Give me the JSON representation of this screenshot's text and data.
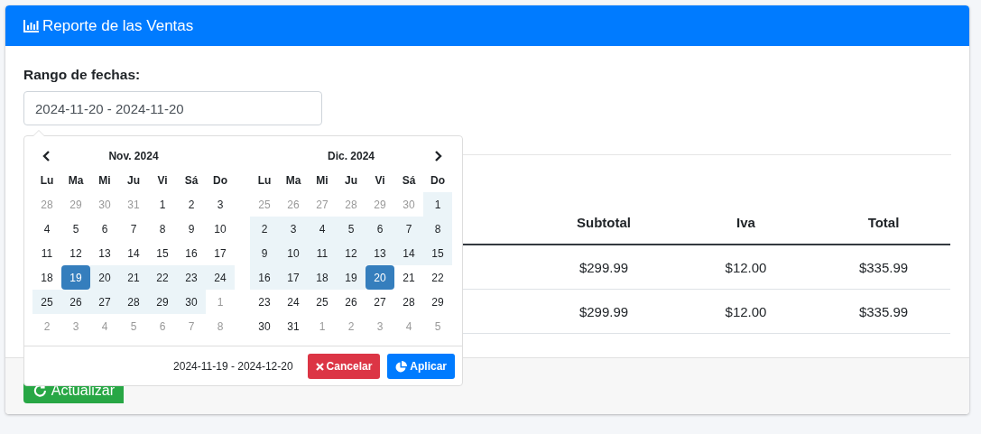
{
  "card": {
    "title": "Reporte de las Ventas"
  },
  "date_range": {
    "label": "Rango de fechas:",
    "value": "2024-11-20 - 2024-11-20"
  },
  "table": {
    "columns": [
      "Subtotal",
      "Iva",
      "Total"
    ],
    "rows": [
      [
        "$299.99",
        "$12.00",
        "$335.99"
      ],
      [
        "$299.99",
        "$12.00",
        "$335.99"
      ]
    ]
  },
  "footer": {
    "refresh_button": "Actualizar"
  },
  "date_picker": {
    "calendars": [
      {
        "month": "Nov. 2024",
        "weekdays": [
          "Lu",
          "Ma",
          "Mi",
          "Ju",
          "Vi",
          "Sá",
          "Do"
        ],
        "weeks": [
          [
            {
              "d": "28",
              "off": true,
              "in_range": false,
              "selected": false
            },
            {
              "d": "29",
              "off": true,
              "in_range": false,
              "selected": false
            },
            {
              "d": "30",
              "off": true,
              "in_range": false,
              "selected": false
            },
            {
              "d": "31",
              "off": true,
              "in_range": false,
              "selected": false
            },
            {
              "d": "1",
              "off": false,
              "in_range": false,
              "selected": false
            },
            {
              "d": "2",
              "off": false,
              "in_range": false,
              "selected": false
            },
            {
              "d": "3",
              "off": false,
              "in_range": false,
              "selected": false
            }
          ],
          [
            {
              "d": "4",
              "off": false,
              "in_range": false,
              "selected": false
            },
            {
              "d": "5",
              "off": false,
              "in_range": false,
              "selected": false
            },
            {
              "d": "6",
              "off": false,
              "in_range": false,
              "selected": false
            },
            {
              "d": "7",
              "off": false,
              "in_range": false,
              "selected": false
            },
            {
              "d": "8",
              "off": false,
              "in_range": false,
              "selected": false
            },
            {
              "d": "9",
              "off": false,
              "in_range": false,
              "selected": false
            },
            {
              "d": "10",
              "off": false,
              "in_range": false,
              "selected": false
            }
          ],
          [
            {
              "d": "11",
              "off": false,
              "in_range": false,
              "selected": false
            },
            {
              "d": "12",
              "off": false,
              "in_range": false,
              "selected": false
            },
            {
              "d": "13",
              "off": false,
              "in_range": false,
              "selected": false
            },
            {
              "d": "14",
              "off": false,
              "in_range": false,
              "selected": false
            },
            {
              "d": "15",
              "off": false,
              "in_range": false,
              "selected": false
            },
            {
              "d": "16",
              "off": false,
              "in_range": false,
              "selected": false
            },
            {
              "d": "17",
              "off": false,
              "in_range": false,
              "selected": false
            }
          ],
          [
            {
              "d": "18",
              "off": false,
              "in_range": false,
              "selected": false
            },
            {
              "d": "19",
              "off": false,
              "in_range": true,
              "selected": true
            },
            {
              "d": "20",
              "off": false,
              "in_range": true,
              "selected": false
            },
            {
              "d": "21",
              "off": false,
              "in_range": true,
              "selected": false
            },
            {
              "d": "22",
              "off": false,
              "in_range": true,
              "selected": false
            },
            {
              "d": "23",
              "off": false,
              "in_range": true,
              "selected": false
            },
            {
              "d": "24",
              "off": false,
              "in_range": true,
              "selected": false
            }
          ],
          [
            {
              "d": "25",
              "off": false,
              "in_range": true,
              "selected": false
            },
            {
              "d": "26",
              "off": false,
              "in_range": true,
              "selected": false
            },
            {
              "d": "27",
              "off": false,
              "in_range": true,
              "selected": false
            },
            {
              "d": "28",
              "off": false,
              "in_range": true,
              "selected": false
            },
            {
              "d": "29",
              "off": false,
              "in_range": true,
              "selected": false
            },
            {
              "d": "30",
              "off": false,
              "in_range": true,
              "selected": false
            },
            {
              "d": "1",
              "off": true,
              "in_range": false,
              "selected": false
            }
          ],
          [
            {
              "d": "2",
              "off": true,
              "in_range": false,
              "selected": false
            },
            {
              "d": "3",
              "off": true,
              "in_range": false,
              "selected": false
            },
            {
              "d": "4",
              "off": true,
              "in_range": false,
              "selected": false
            },
            {
              "d": "5",
              "off": true,
              "in_range": false,
              "selected": false
            },
            {
              "d": "6",
              "off": true,
              "in_range": false,
              "selected": false
            },
            {
              "d": "7",
              "off": true,
              "in_range": false,
              "selected": false
            },
            {
              "d": "8",
              "off": true,
              "in_range": false,
              "selected": false
            }
          ]
        ]
      },
      {
        "month": "Dic. 2024",
        "weekdays": [
          "Lu",
          "Ma",
          "Mi",
          "Ju",
          "Vi",
          "Sá",
          "Do"
        ],
        "weeks": [
          [
            {
              "d": "25",
              "off": true,
              "in_range": false,
              "selected": false
            },
            {
              "d": "26",
              "off": true,
              "in_range": false,
              "selected": false
            },
            {
              "d": "27",
              "off": true,
              "in_range": false,
              "selected": false
            },
            {
              "d": "28",
              "off": true,
              "in_range": false,
              "selected": false
            },
            {
              "d": "29",
              "off": true,
              "in_range": false,
              "selected": false
            },
            {
              "d": "30",
              "off": true,
              "in_range": false,
              "selected": false
            },
            {
              "d": "1",
              "off": false,
              "in_range": true,
              "selected": false
            }
          ],
          [
            {
              "d": "2",
              "off": false,
              "in_range": true,
              "selected": false
            },
            {
              "d": "3",
              "off": false,
              "in_range": true,
              "selected": false
            },
            {
              "d": "4",
              "off": false,
              "in_range": true,
              "selected": false
            },
            {
              "d": "5",
              "off": false,
              "in_range": true,
              "selected": false
            },
            {
              "d": "6",
              "off": false,
              "in_range": true,
              "selected": false
            },
            {
              "d": "7",
              "off": false,
              "in_range": true,
              "selected": false
            },
            {
              "d": "8",
              "off": false,
              "in_range": true,
              "selected": false
            }
          ],
          [
            {
              "d": "9",
              "off": false,
              "in_range": true,
              "selected": false
            },
            {
              "d": "10",
              "off": false,
              "in_range": true,
              "selected": false
            },
            {
              "d": "11",
              "off": false,
              "in_range": true,
              "selected": false
            },
            {
              "d": "12",
              "off": false,
              "in_range": true,
              "selected": false
            },
            {
              "d": "13",
              "off": false,
              "in_range": true,
              "selected": false
            },
            {
              "d": "14",
              "off": false,
              "in_range": true,
              "selected": false
            },
            {
              "d": "15",
              "off": false,
              "in_range": true,
              "selected": false
            }
          ],
          [
            {
              "d": "16",
              "off": false,
              "in_range": true,
              "selected": false
            },
            {
              "d": "17",
              "off": false,
              "in_range": true,
              "selected": false
            },
            {
              "d": "18",
              "off": false,
              "in_range": true,
              "selected": false
            },
            {
              "d": "19",
              "off": false,
              "in_range": true,
              "selected": false
            },
            {
              "d": "20",
              "off": false,
              "in_range": true,
              "selected": true
            },
            {
              "d": "21",
              "off": false,
              "in_range": false,
              "selected": false
            },
            {
              "d": "22",
              "off": false,
              "in_range": false,
              "selected": false
            }
          ],
          [
            {
              "d": "23",
              "off": false,
              "in_range": false,
              "selected": false
            },
            {
              "d": "24",
              "off": false,
              "in_range": false,
              "selected": false
            },
            {
              "d": "25",
              "off": false,
              "in_range": false,
              "selected": false
            },
            {
              "d": "26",
              "off": false,
              "in_range": false,
              "selected": false
            },
            {
              "d": "27",
              "off": false,
              "in_range": false,
              "selected": false
            },
            {
              "d": "28",
              "off": false,
              "in_range": false,
              "selected": false
            },
            {
              "d": "29",
              "off": false,
              "in_range": false,
              "selected": false
            }
          ],
          [
            {
              "d": "30",
              "off": false,
              "in_range": false,
              "selected": false
            },
            {
              "d": "31",
              "off": false,
              "in_range": false,
              "selected": false
            },
            {
              "d": "1",
              "off": true,
              "in_range": false,
              "selected": false
            },
            {
              "d": "2",
              "off": true,
              "in_range": false,
              "selected": false
            },
            {
              "d": "3",
              "off": true,
              "in_range": false,
              "selected": false
            },
            {
              "d": "4",
              "off": true,
              "in_range": false,
              "selected": false
            },
            {
              "d": "5",
              "off": true,
              "in_range": false,
              "selected": false
            }
          ]
        ]
      }
    ],
    "selected_range": "2024-11-19 - 2024-12-20",
    "cancel_button": "Cancelar",
    "apply_button": "Aplicar"
  }
}
